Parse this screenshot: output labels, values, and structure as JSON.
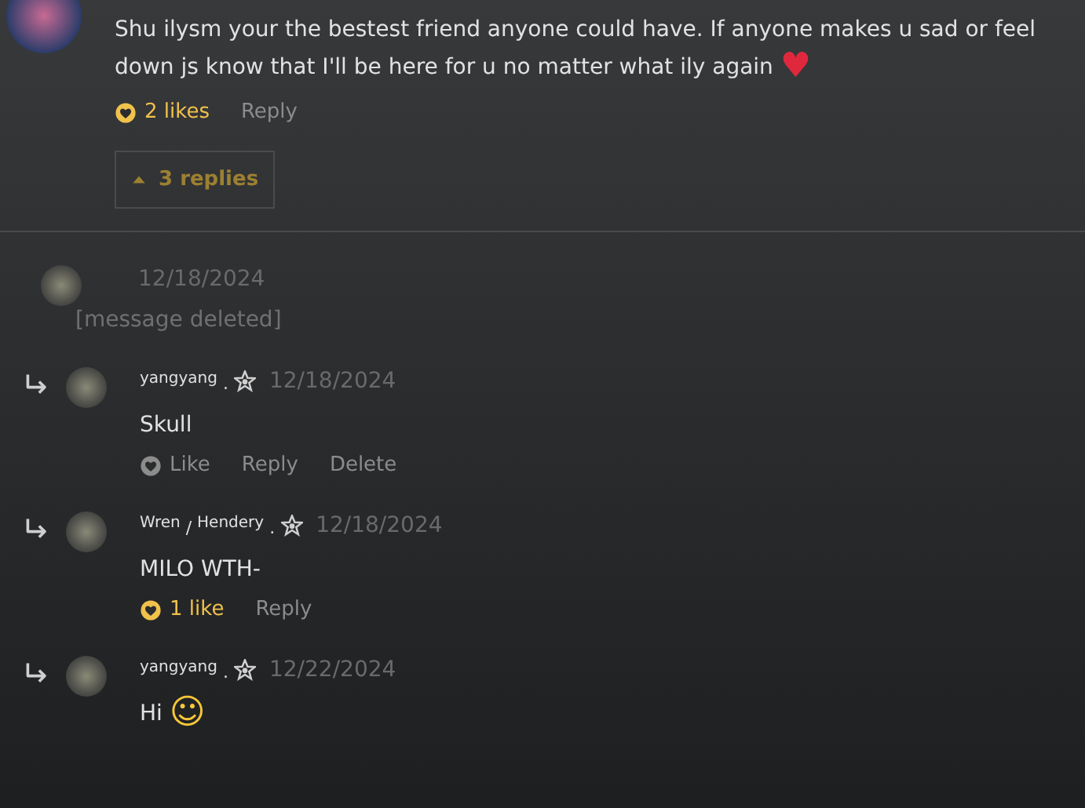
{
  "comment": {
    "text": "Shu ilysm your the bestest friend anyone could have. If anyone makes u sad or feel down js know that I'll be here for u no matter what ily again",
    "emoji": "♥",
    "like": {
      "label": "2 likes",
      "liked": true
    },
    "actions": [
      "Reply"
    ],
    "replies_toggle": {
      "label": "3 replies",
      "expanded": true
    }
  },
  "thread": [
    {
      "kind": "deleted",
      "date": "12/18/2024",
      "text": "[message deleted]"
    },
    {
      "kind": "reply",
      "author": "$^{yangyang}$ .",
      "date": "12/18/2024",
      "text": "Skull",
      "like": {
        "label": "Like",
        "liked": false
      },
      "actions": [
        "Reply",
        "Delete"
      ]
    },
    {
      "kind": "reply",
      "author": "$^{Wren}$ / $^{Hendery}$ .",
      "date": "12/18/2024",
      "text": "MILO WTH-",
      "like": {
        "label": "1 like",
        "liked": true
      },
      "actions": [
        "Reply"
      ]
    },
    {
      "kind": "reply",
      "author": "$^{yangyang}$ .",
      "date": "12/22/2024",
      "text": "Hi",
      "emoji": "☺"
    }
  ]
}
